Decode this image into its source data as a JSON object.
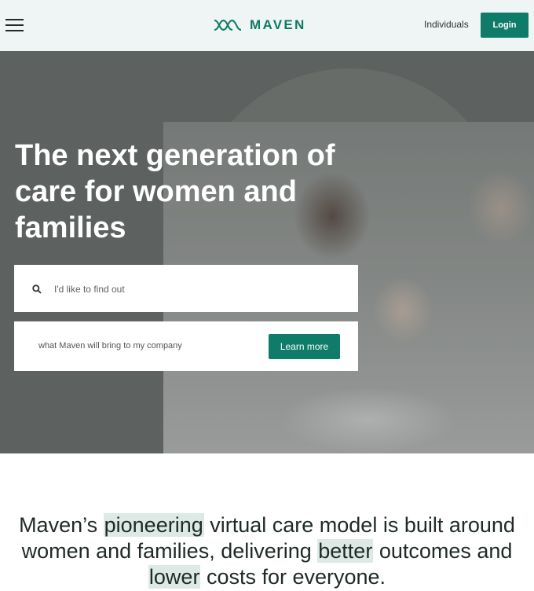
{
  "header": {
    "logo_text": "MAVEN",
    "logo_mark": "maven-logo-icon",
    "nav_individuals": "Individuals",
    "login_label": "Login",
    "menu_icon": "hamburger-menu-icon"
  },
  "hero": {
    "title": "The next generation of care for women and families",
    "search_placeholder": "I'd like to find out",
    "company_prompt": "what Maven will bring to my company",
    "learn_more_label": "Learn more",
    "search_icon": "search-icon"
  },
  "mission": {
    "part1": "Maven’s ",
    "hl1": "pioneering",
    "part2": " virtual care model is built around women and families, delivering ",
    "hl2": "better",
    "part3": " outcomes and ",
    "hl3": "lower",
    "part4": " costs for everyone."
  },
  "colors": {
    "brand_green": "#0e7c68",
    "header_bg": "#eef5f4",
    "highlight": "#dde9e5"
  }
}
